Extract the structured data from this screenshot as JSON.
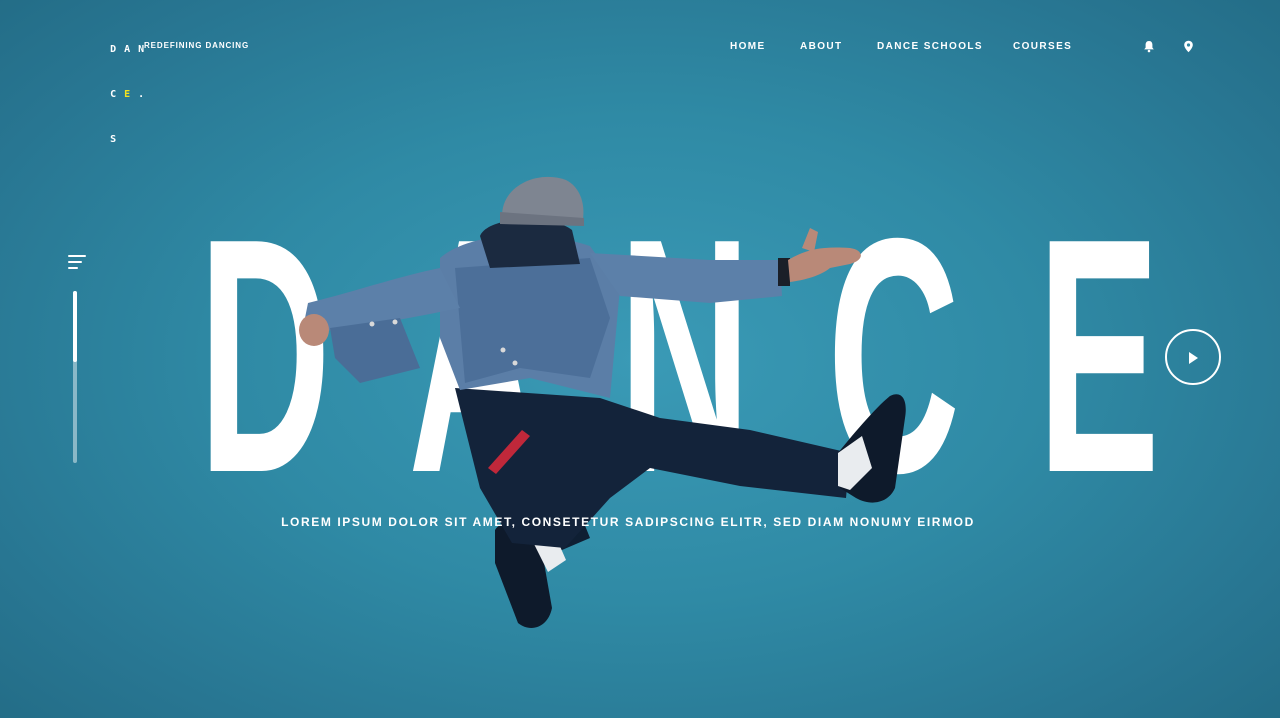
{
  "logo": {
    "rows": [
      [
        "D",
        "A",
        "N"
      ],
      [
        "C",
        "E",
        "."
      ],
      [
        "S"
      ]
    ],
    "accent_color": "#f2e21e"
  },
  "tagline": "REDEFINING DANCING",
  "nav": {
    "items": [
      "HOME",
      "ABOUT",
      "DANCE SCHOOLS",
      "COURSES"
    ]
  },
  "icons": {
    "notifications": "bell-icon",
    "location": "map-pin-icon",
    "menu": "menu-icon",
    "play": "play-icon"
  },
  "hero": {
    "letters": [
      "D",
      "A",
      "N",
      "C",
      "E"
    ],
    "subtitle": "LOREM IPSUM DOLOR SIT AMET, CONSETETUR SADIPSCING ELITR, SED DIAM NONUMY EIRMOD"
  },
  "scroll": {
    "position": 0.0,
    "visible_fraction": 0.41
  },
  "colors": {
    "background": "#2f8aa5",
    "background_center": "#3a9ab6",
    "text": "#ffffff",
    "accent": "#f2e21e"
  }
}
